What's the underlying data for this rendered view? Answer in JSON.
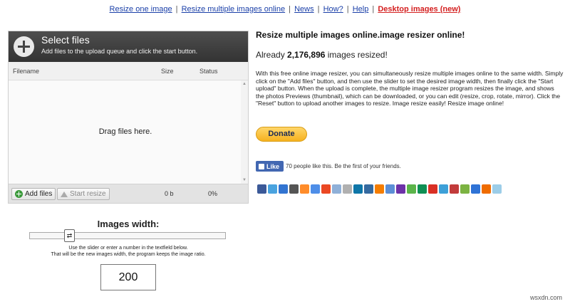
{
  "nav": {
    "links": [
      {
        "label": "Resize one image"
      },
      {
        "label": "Resize multiple images online"
      },
      {
        "label": "News"
      },
      {
        "label": "How?"
      },
      {
        "label": "Help"
      },
      {
        "label": "Desktop images (new)"
      }
    ],
    "separator": "|"
  },
  "uploader": {
    "title": "Select files",
    "subtitle": "Add files to the upload queue and click the start button.",
    "columns": {
      "filename": "Filename",
      "size": "Size",
      "status": "Status"
    },
    "drop_text": "Drag files here.",
    "add_label": "Add files",
    "start_label": "Start resize",
    "total_size": "0 b",
    "total_status": "0%"
  },
  "width": {
    "label": "Images width:",
    "hint_line1": "Use the slider or enter a number in the textfield below.",
    "hint_line2": "That will be the new images width, the program keeps the image ratio.",
    "value": "200",
    "handle_glyph": "⇄"
  },
  "info": {
    "title": "Resize multiple images online.image resizer online!",
    "count_prefix": "Already ",
    "count": "2,176,896",
    "count_suffix": " images resized!",
    "description": "With this free online image resizer, you can simultaneously resize multiple images online to the same width. Simply click on the \"Add files\" button, and then use the slider to set the desired image width, then finally click the \"Start upload\" button. When the upload is complete, the multiple image resizer program resizes the image, and shows the photos Previews (thumbnail), which can be downloaded, or you can edit (resize, crop, rotate, mirror). Click the \"Reset\" button to upload another images to resize. Image resize easily! Resize image online!",
    "donate_label": "Donate",
    "like_label": "Like",
    "like_text": "70 people like this. Be the first of your friends."
  },
  "share_icons": [
    {
      "name": "facebook-icon",
      "color": "#3b5998"
    },
    {
      "name": "twitter-icon",
      "color": "#4aa3df"
    },
    {
      "name": "delicious-icon",
      "color": "#3274d1"
    },
    {
      "name": "myspace-icon",
      "color": "#555555"
    },
    {
      "name": "reddit-icon",
      "color": "#ff8c2a"
    },
    {
      "name": "google-icon",
      "color": "#4e8ee8"
    },
    {
      "name": "stumbleupon-icon",
      "color": "#eb4823"
    },
    {
      "name": "email-icon",
      "color": "#8fb0d8"
    },
    {
      "name": "print-icon",
      "color": "#b0b0b0"
    },
    {
      "name": "linkedin-icon",
      "color": "#0e76a8"
    },
    {
      "name": "digg-icon",
      "color": "#356aa0"
    },
    {
      "name": "blogger-icon",
      "color": "#f57d00"
    },
    {
      "name": "friendfeed-icon",
      "color": "#5c8fd6"
    },
    {
      "name": "yahoo-icon",
      "color": "#6d32a8"
    },
    {
      "name": "technorati-icon",
      "color": "#5bb44a"
    },
    {
      "name": "newsvine-icon",
      "color": "#0f8f54"
    },
    {
      "name": "gmail-icon",
      "color": "#d93025"
    },
    {
      "name": "share-plus-icon",
      "color": "#3da0d8"
    },
    {
      "name": "mixx-icon",
      "color": "#c23b3b"
    },
    {
      "name": "netvibes-icon",
      "color": "#7cb342"
    },
    {
      "name": "diigo-icon",
      "color": "#2f73d6"
    },
    {
      "name": "buzz-icon",
      "color": "#ef6c00"
    },
    {
      "name": "posterous-icon",
      "color": "#9ccde8"
    }
  ],
  "watermark": "wsxdn.com"
}
